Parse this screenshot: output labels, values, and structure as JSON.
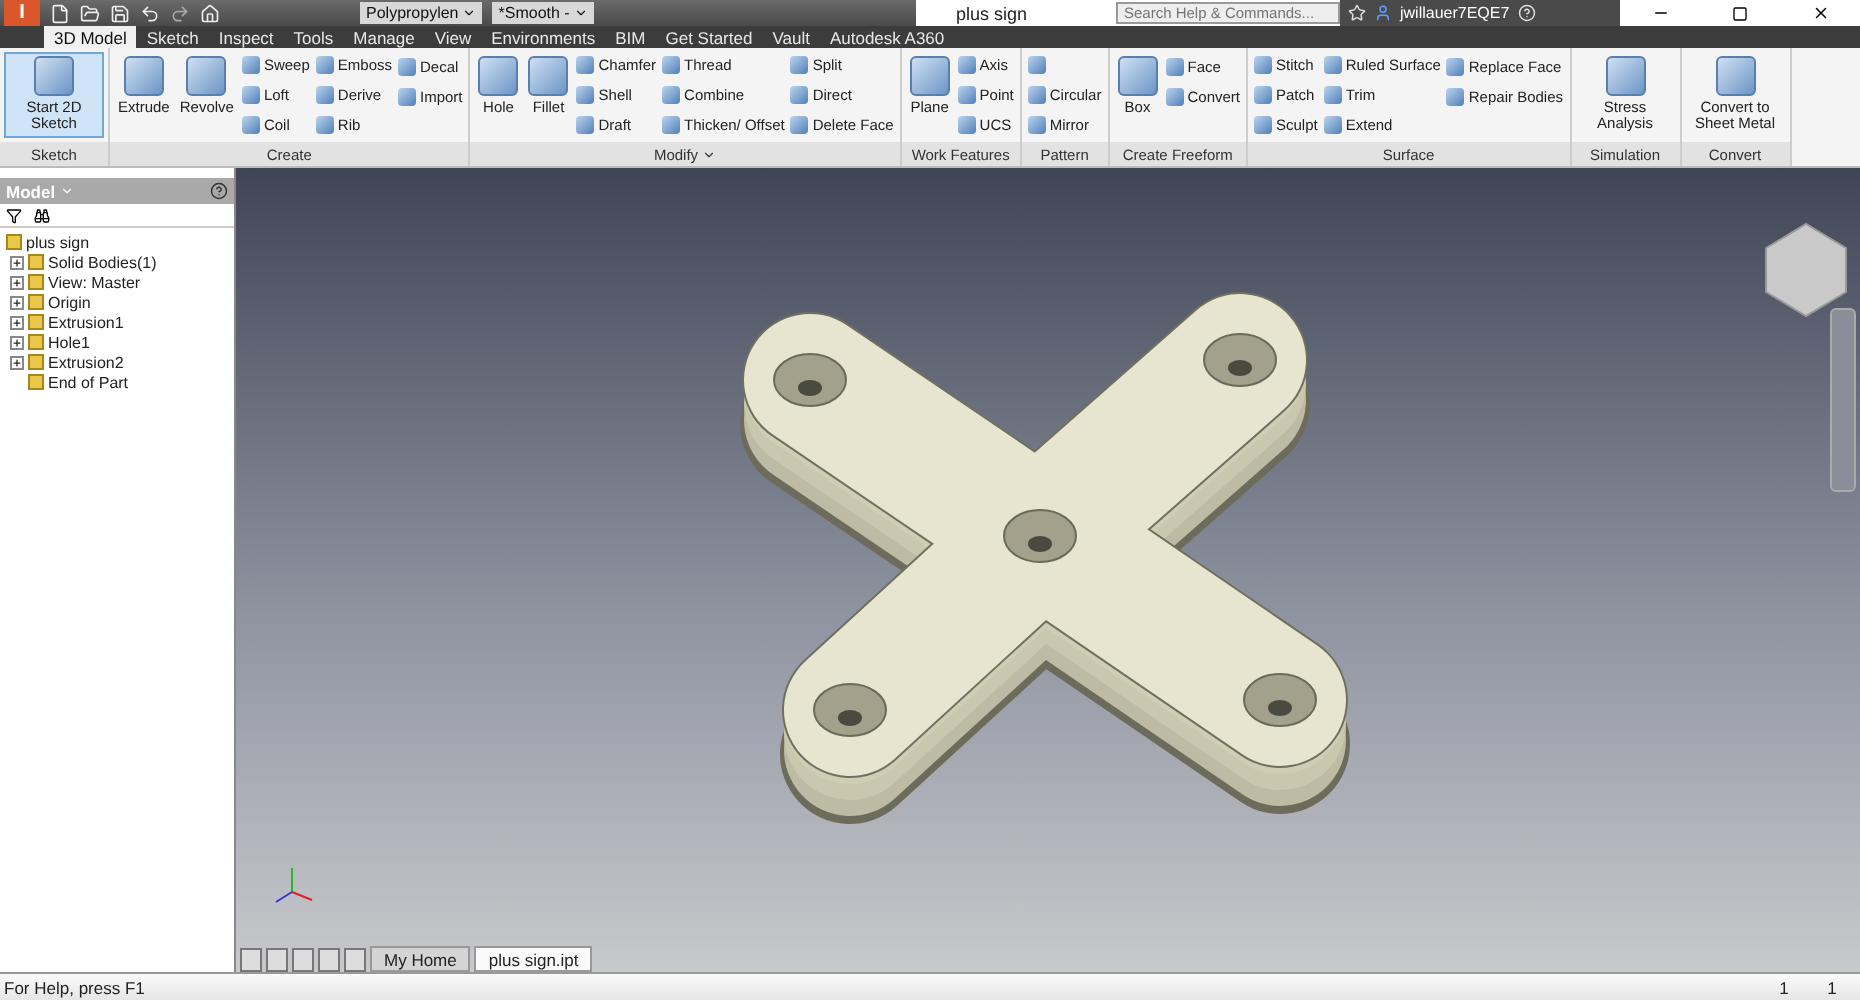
{
  "title_bar": {
    "logo": "I",
    "material": "Polypropylen",
    "appearance": "*Smooth -",
    "title": "plus sign",
    "search": {
      "placeholder": "Search Help & Commands..."
    },
    "user": "jwillauer7EQE7"
  },
  "tabs": [
    {
      "label": "3D Model",
      "selected": true
    },
    {
      "label": "Sketch",
      "selected": false
    },
    {
      "label": "Inspect",
      "selected": false
    },
    {
      "label": "Tools",
      "selected": false
    },
    {
      "label": "Manage",
      "selected": false
    },
    {
      "label": "View",
      "selected": false
    },
    {
      "label": "Environments",
      "selected": false
    },
    {
      "label": "BIM",
      "selected": false
    },
    {
      "label": "Get Started",
      "selected": false
    },
    {
      "label": "Vault",
      "selected": false
    },
    {
      "label": "Autodesk A360",
      "selected": false
    }
  ],
  "ribbon": {
    "panels": [
      {
        "label": "Sketch",
        "dropdown": false,
        "large": [
          {
            "label": "Start 2D Sketch",
            "highlighted": true
          }
        ]
      },
      {
        "label": "Create",
        "dropdown": false,
        "large": [
          {
            "label": "Extrude",
            "highlighted": false
          },
          {
            "label": "Revolve",
            "highlighted": false
          }
        ],
        "columns": [
          [
            "Sweep",
            "Loft",
            "Coil"
          ],
          [
            "Emboss",
            "Derive",
            "Rib"
          ],
          [
            "Decal",
            "Import"
          ]
        ]
      },
      {
        "label": "Modify",
        "dropdown": true,
        "large": [
          {
            "label": "Hole",
            "highlighted": false
          },
          {
            "label": "Fillet",
            "highlighted": false
          }
        ],
        "columns": [
          [
            "Chamfer",
            "Shell",
            "Draft"
          ],
          [
            "Thread",
            "Combine",
            "Thicken/ Offset"
          ],
          [
            "Split",
            "Direct",
            "Delete Face"
          ]
        ]
      },
      {
        "label": "Work Features",
        "dropdown": false,
        "large": [
          {
            "label": "Plane",
            "highlighted": false
          }
        ],
        "columns": [
          [
            "Axis",
            "Point",
            "UCS"
          ]
        ]
      },
      {
        "label": "Pattern",
        "dropdown": false,
        "columns": [
          [
            "",
            "Circular",
            "Mirror"
          ]
        ]
      },
      {
        "label": "Create Freeform",
        "dropdown": false,
        "large": [
          {
            "label": "Box",
            "highlighted": false
          }
        ],
        "columns": [
          [
            "Face",
            "Convert"
          ]
        ]
      },
      {
        "label": "Surface",
        "dropdown": false,
        "columns": [
          [
            "Stitch",
            "Patch",
            "Sculpt"
          ],
          [
            "Ruled Surface",
            "Trim",
            "Extend"
          ],
          [
            "Replace Face",
            "Repair Bodies"
          ]
        ]
      },
      {
        "label": "Simulation",
        "dropdown": false,
        "large": [
          {
            "label": "Stress Analysis",
            "highlighted": false
          }
        ]
      },
      {
        "label": "Convert",
        "dropdown": false,
        "large": [
          {
            "label": "Convert to Sheet Metal",
            "highlighted": false
          }
        ]
      }
    ]
  },
  "browser": {
    "title": "Model",
    "tree": {
      "label": "plus sign",
      "children": [
        {
          "label": "Solid Bodies(1)",
          "expandable": true
        },
        {
          "label": "View: Master",
          "expandable": true
        },
        {
          "label": "Origin",
          "expandable": true
        },
        {
          "label": "Extrusion1",
          "expandable": true
        },
        {
          "label": "Hole1",
          "expandable": true
        },
        {
          "label": "Extrusion2",
          "expandable": true
        },
        {
          "label": "End of Part",
          "expandable": false
        }
      ]
    }
  },
  "document_tabs": [
    {
      "label": "My Home",
      "selected": false
    },
    {
      "label": "plus sign.ipt",
      "selected": true
    }
  ],
  "status_bar": {
    "help": "For Help, press F1",
    "values": [
      "1",
      "1"
    ]
  }
}
